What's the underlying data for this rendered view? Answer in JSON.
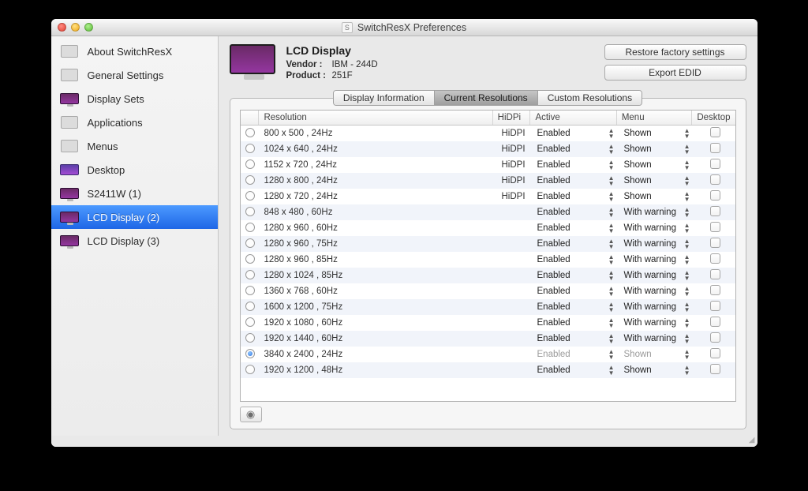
{
  "window": {
    "title": "SwitchResX Preferences"
  },
  "sidebar": {
    "items": [
      {
        "label": "About SwitchResX",
        "icon": "generic"
      },
      {
        "label": "General Settings",
        "icon": "generic"
      },
      {
        "label": "Display Sets",
        "icon": "display"
      },
      {
        "label": "Applications",
        "icon": "generic"
      },
      {
        "label": "Menus",
        "icon": "generic"
      },
      {
        "label": "Desktop",
        "icon": "desktop"
      },
      {
        "label": "S2411W (1)",
        "icon": "display"
      },
      {
        "label": "LCD Display (2)",
        "icon": "display",
        "selected": true
      },
      {
        "label": "LCD Display (3)",
        "icon": "display"
      }
    ]
  },
  "header": {
    "display_name": "LCD Display",
    "vendor_label": "Vendor :",
    "vendor_value": "IBM - 244D",
    "product_label": "Product :",
    "product_value": "251F",
    "restore_button": "Restore factory settings",
    "export_button": "Export EDID"
  },
  "tabs": [
    {
      "label": "Display Information"
    },
    {
      "label": "Current Resolutions",
      "selected": true
    },
    {
      "label": "Custom Resolutions"
    }
  ],
  "columns": {
    "resolution": "Resolution",
    "hidpi": "HiDPi",
    "active": "Active",
    "menu": "Menu",
    "desktop": "Desktop"
  },
  "rows": [
    {
      "res": "800 x 500   , 24Hz",
      "hidpi": "HiDPI",
      "active": "Enabled",
      "menu": "Shown"
    },
    {
      "res": "1024 x 640  , 24Hz",
      "hidpi": "HiDPI",
      "active": "Enabled",
      "menu": "Shown"
    },
    {
      "res": "1152 x 720  , 24Hz",
      "hidpi": "HiDPI",
      "active": "Enabled",
      "menu": "Shown"
    },
    {
      "res": "1280 x 800  , 24Hz",
      "hidpi": "HiDPI",
      "active": "Enabled",
      "menu": "Shown"
    },
    {
      "res": "1280 x 720  , 24Hz",
      "hidpi": "HiDPI",
      "active": "Enabled",
      "menu": "Shown"
    },
    {
      "res": "848 x 480   , 60Hz",
      "hidpi": "",
      "active": "Enabled",
      "menu": "With warning"
    },
    {
      "res": "1280 x 960  , 60Hz",
      "hidpi": "",
      "active": "Enabled",
      "menu": "With warning"
    },
    {
      "res": "1280 x 960  , 75Hz",
      "hidpi": "",
      "active": "Enabled",
      "menu": "With warning"
    },
    {
      "res": "1280 x 960  , 85Hz",
      "hidpi": "",
      "active": "Enabled",
      "menu": "With warning"
    },
    {
      "res": "1280 x 1024 , 85Hz",
      "hidpi": "",
      "active": "Enabled",
      "menu": "With warning"
    },
    {
      "res": "1360 x 768  , 60Hz",
      "hidpi": "",
      "active": "Enabled",
      "menu": "With warning"
    },
    {
      "res": "1600 x 1200 , 75Hz",
      "hidpi": "",
      "active": "Enabled",
      "menu": "With warning"
    },
    {
      "res": "1920 x 1080 , 60Hz",
      "hidpi": "",
      "active": "Enabled",
      "menu": "With warning"
    },
    {
      "res": "1920 x 1440 , 60Hz",
      "hidpi": "",
      "active": "Enabled",
      "menu": "With warning"
    },
    {
      "res": "3840 x 2400 , 24Hz",
      "hidpi": "",
      "active": "Enabled",
      "menu": "Shown",
      "selected": true,
      "dim": true
    },
    {
      "res": "1920 x 1200 , 48Hz",
      "hidpi": "",
      "active": "Enabled",
      "menu": "Shown"
    }
  ]
}
